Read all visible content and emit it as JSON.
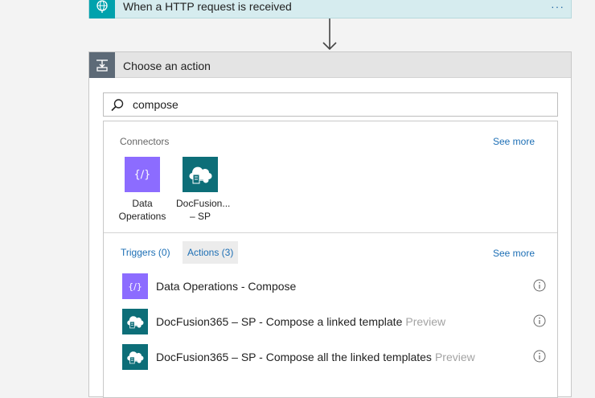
{
  "trigger": {
    "title": "When a HTTP request is received",
    "menu": "···",
    "icon": "globe-icon",
    "color": "#00a2ad"
  },
  "action": {
    "header": "Choose an action",
    "icon": "action-icon",
    "search_value": "compose"
  },
  "connectors": {
    "label": "Connectors",
    "see_more": "See more",
    "items": [
      {
        "name": "Data\nOperations",
        "icon": "data-operations-icon",
        "color": "#8c6cff"
      },
      {
        "name": "DocFusion...\n– SP",
        "icon": "docfusion-icon",
        "color": "#0d6e78"
      }
    ]
  },
  "tabs": {
    "triggers": "Triggers (0)",
    "actions": "Actions (3)",
    "see_more": "See more"
  },
  "actions": [
    {
      "label": "Data Operations - Compose",
      "preview": "",
      "icon": "data-operations-icon",
      "color": "#8c6cff"
    },
    {
      "label": "DocFusion365 – SP - Compose a linked template",
      "preview": "Preview",
      "icon": "docfusion-icon",
      "color": "#0d6e78"
    },
    {
      "label": "DocFusion365 – SP - Compose all the linked templates",
      "preview": "Preview",
      "icon": "docfusion-icon",
      "color": "#0d6e78"
    }
  ]
}
